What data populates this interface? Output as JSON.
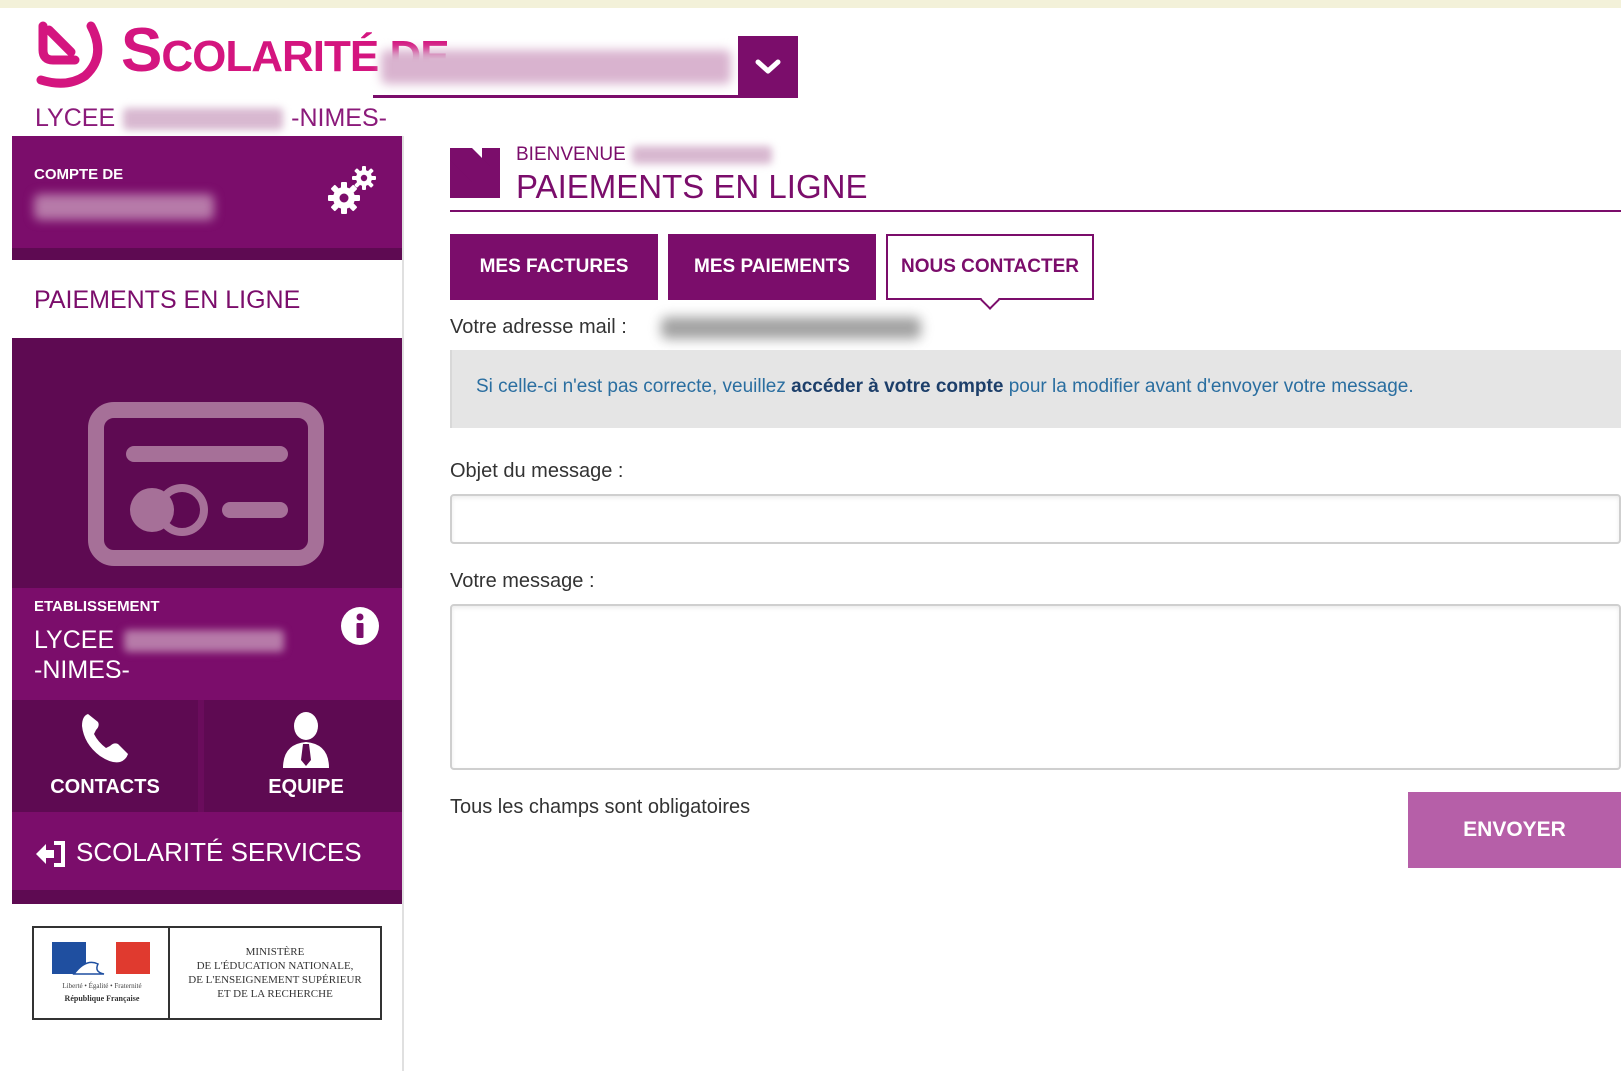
{
  "header": {
    "brand_title_cap": "S",
    "brand_title_rest": "COLARITÉ DE",
    "school_prefix": "LYCEE",
    "school_suffix": "-NIMES-"
  },
  "sidebar": {
    "account_label": "COMPTE DE",
    "section_title": "PAIEMENTS EN LIGNE",
    "etablissement_label": "ETABLISSEMENT",
    "etablissement_line1": "LYCEE",
    "etablissement_line2": "-NIMES-",
    "contacts_label": "CONTACTS",
    "equipe_label": "EQUIPE",
    "services_label": "SCOLARITÉ SERVICES",
    "ministry": {
      "line1": "MINISTÈRE",
      "line2": "DE L'ÉDUCATION NATIONALE,",
      "line3": "DE L'ENSEIGNEMENT SUPÉRIEUR",
      "line4": "ET DE LA RECHERCHE",
      "flag_motto": "Liberté • Égalité • Fraternité",
      "flag_caption": "République Française"
    }
  },
  "main": {
    "welcome_label": "BIENVENUE",
    "page_title": "PAIEMENTS EN LIGNE",
    "tabs": [
      {
        "label": "MES FACTURES"
      },
      {
        "label": "MES PAIEMENTS"
      },
      {
        "label": "NOUS CONTACTER"
      }
    ],
    "email_label": "Votre adresse mail :",
    "notice_pre": "Si celle-ci n'est pas correcte, veuillez ",
    "notice_link": "accéder à votre compte",
    "notice_post": " pour la modifier avant d'envoyer votre message.",
    "subject_label": "Objet du message :",
    "subject_value": "",
    "message_label": "Votre message :",
    "message_value": "",
    "required_note": "Tous les champs sont obligatoires",
    "send_label": "ENVOYER"
  },
  "colors": {
    "brand_pink": "#d4157f",
    "brand_purple": "#7b0d6b",
    "dark_purple": "#5e0a52",
    "send_button": "#b65fa8"
  }
}
